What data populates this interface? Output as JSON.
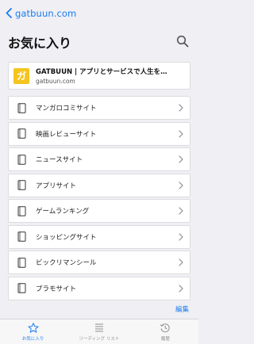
{
  "nav": {
    "back_label": "gatbuun.com"
  },
  "header": {
    "title": "お気に入り"
  },
  "site_card": {
    "logo_glyph": "ガ",
    "title": "GATBUUN | アプリとサービスで人生を…",
    "url": "gatbuun.com",
    "logo_color": "#f4c51e"
  },
  "folders": [
    {
      "label": "マンガロコミサイト"
    },
    {
      "label": "映画レビューサイト"
    },
    {
      "label": "ニュースサイト"
    },
    {
      "label": "アプリサイト"
    },
    {
      "label": "ゲームランキング"
    },
    {
      "label": "ショッピングサイト"
    },
    {
      "label": "ビックリマンシール"
    },
    {
      "label": "プラモサイト"
    }
  ],
  "toolbar": {
    "edit_label": "編集"
  },
  "tabs": [
    {
      "label": "お気に入り",
      "icon": "star-icon",
      "active": true
    },
    {
      "label": "リーディング リスト",
      "icon": "reading-list-icon",
      "active": false
    },
    {
      "label": "履歴",
      "icon": "history-icon",
      "active": false
    }
  ],
  "colors": {
    "accent": "#1a7cf0",
    "background": "#efeff4"
  }
}
